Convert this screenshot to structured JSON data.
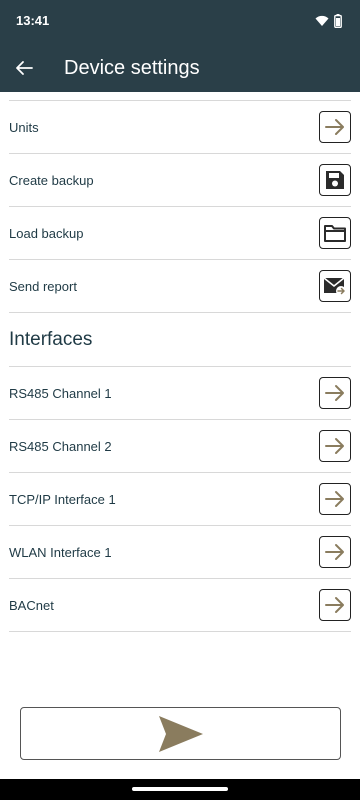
{
  "status_bar": {
    "time": "13:41"
  },
  "header": {
    "title": "Device settings"
  },
  "rows": [
    {
      "label": "Units",
      "icon": "arrow-right-icon"
    },
    {
      "label": "Create backup",
      "icon": "save-icon"
    },
    {
      "label": "Load backup",
      "icon": "folder-icon"
    },
    {
      "label": "Send report",
      "icon": "mail-forward-icon"
    }
  ],
  "interfaces": {
    "heading": "Interfaces",
    "items": [
      {
        "label": "RS485 Channel 1",
        "icon": "arrow-right-icon"
      },
      {
        "label": "RS485 Channel 2",
        "icon": "arrow-right-icon"
      },
      {
        "label": "TCP/IP Interface 1",
        "icon": "arrow-right-icon"
      },
      {
        "label": "WLAN Interface 1",
        "icon": "arrow-right-icon"
      },
      {
        "label": "BACnet",
        "icon": "arrow-right-icon"
      }
    ]
  },
  "colors": {
    "appbar": "#2a3f48",
    "accent": "#8a7c5e",
    "text": "#1f3a45"
  }
}
